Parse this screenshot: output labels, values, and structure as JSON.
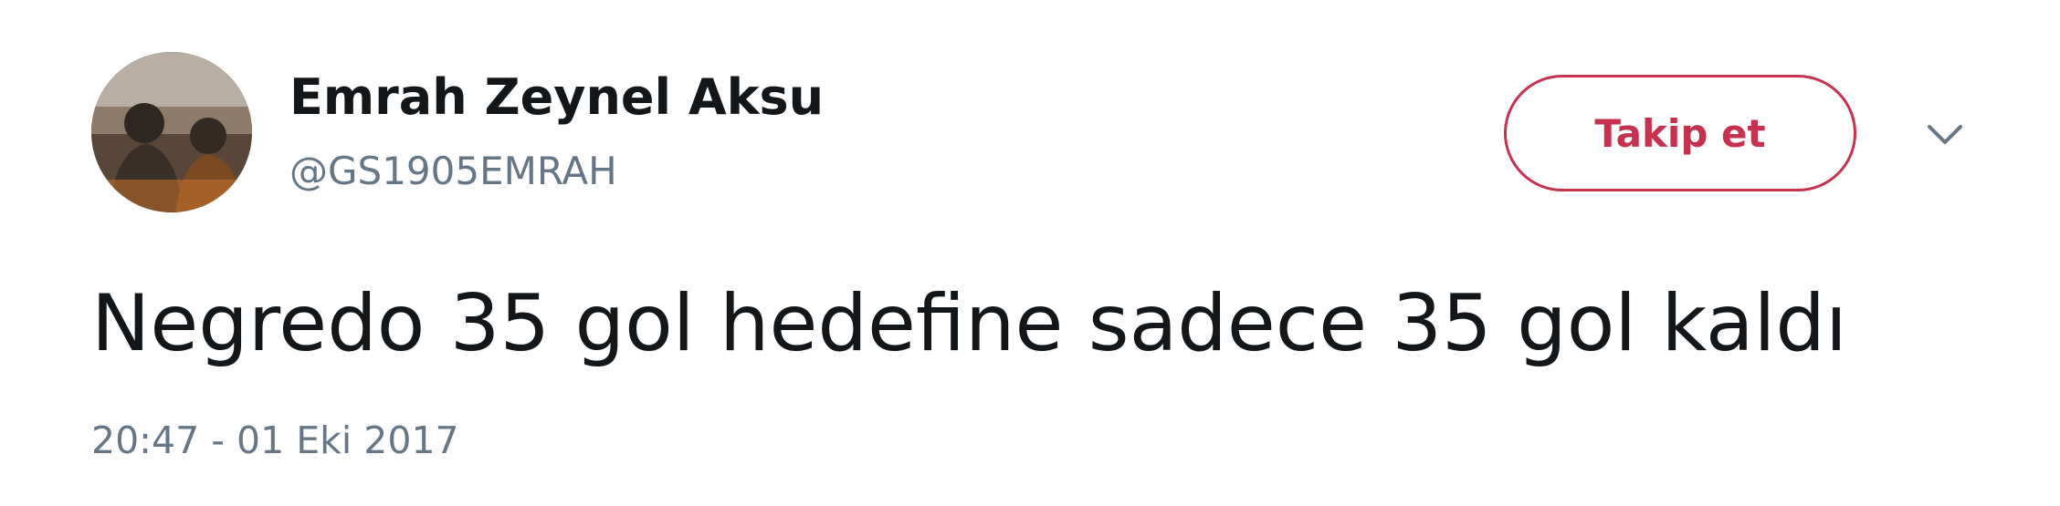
{
  "tweet": {
    "author": {
      "name": "Emrah Zeynel Aksu",
      "handle": "@GS1905EMRAH",
      "avatar_icon": "profile-photo"
    },
    "follow_label": "Takip et",
    "more_icon": "chevron-down-icon",
    "text": "Negredo 35 gol hedefine sadece 35 gol kaldı",
    "timestamp": "20:47 - 01 Eki 2017"
  },
  "colors": {
    "text_primary": "#14171a",
    "text_secondary": "#657786",
    "follow_accent": "#c5314f",
    "background": "#ffffff"
  }
}
